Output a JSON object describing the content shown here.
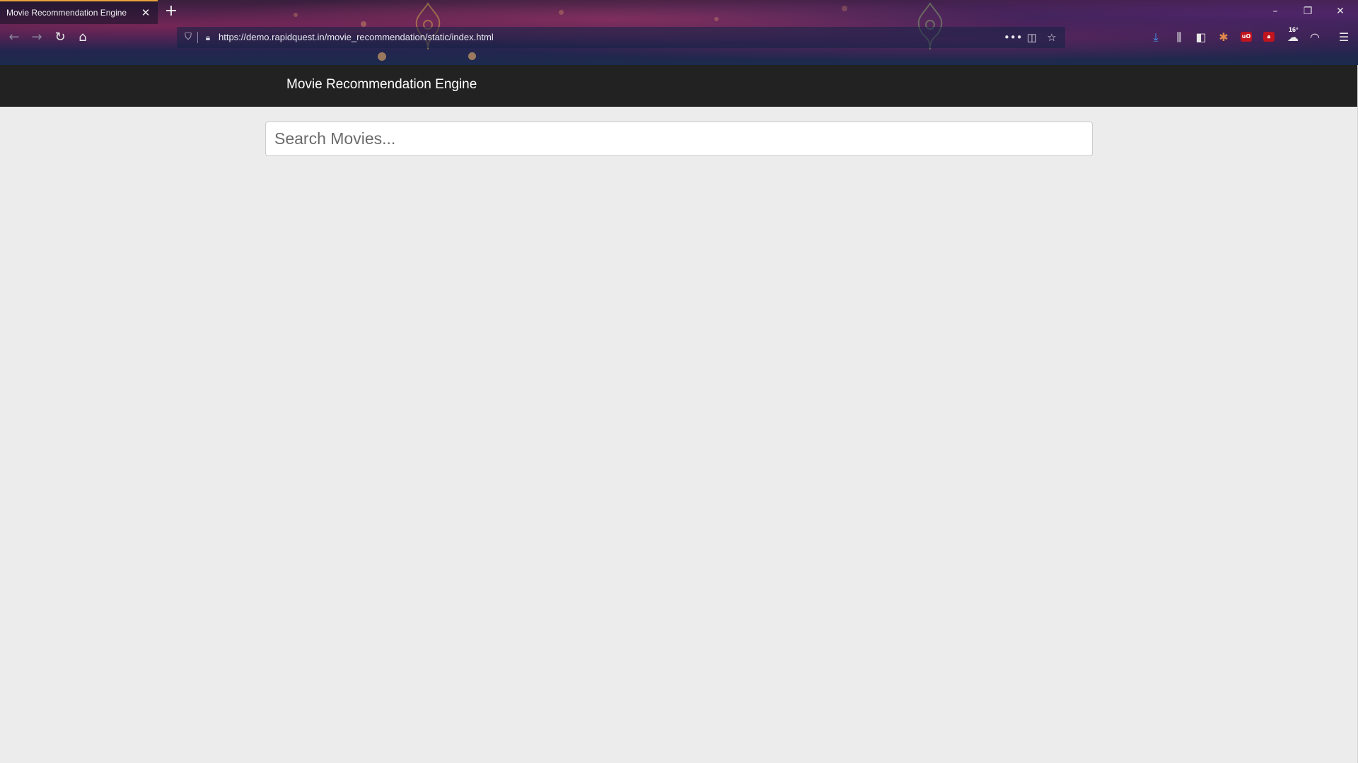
{
  "browser": {
    "tab_title": "Movie Recommendation Engine",
    "tab_close_icon": "close-icon",
    "new_tab_icon": "plus-icon",
    "url": "https://demo.rapidquest.in/movie_recommendation/static/index.html",
    "temperature_badge": "16°",
    "window_controls": [
      "minimize-icon",
      "restore-icon",
      "close-icon"
    ],
    "nav_icons": [
      "back-icon",
      "forward-icon",
      "reload-icon",
      "home-icon"
    ],
    "toolbar_icons": [
      "download-icon",
      "library-icon",
      "sidebar-icon",
      "extension-icon",
      "ublock-icon",
      "lock-extension-icon",
      "weather-icon",
      "profile-icon",
      "menu-icon"
    ],
    "accent_color": "#e8a23a"
  },
  "page": {
    "navbar_title": "Movie Recommendation Engine",
    "navbar_color": "#222222",
    "background_color": "#ececec",
    "search": {
      "placeholder": "Search Movies...",
      "value": ""
    }
  }
}
